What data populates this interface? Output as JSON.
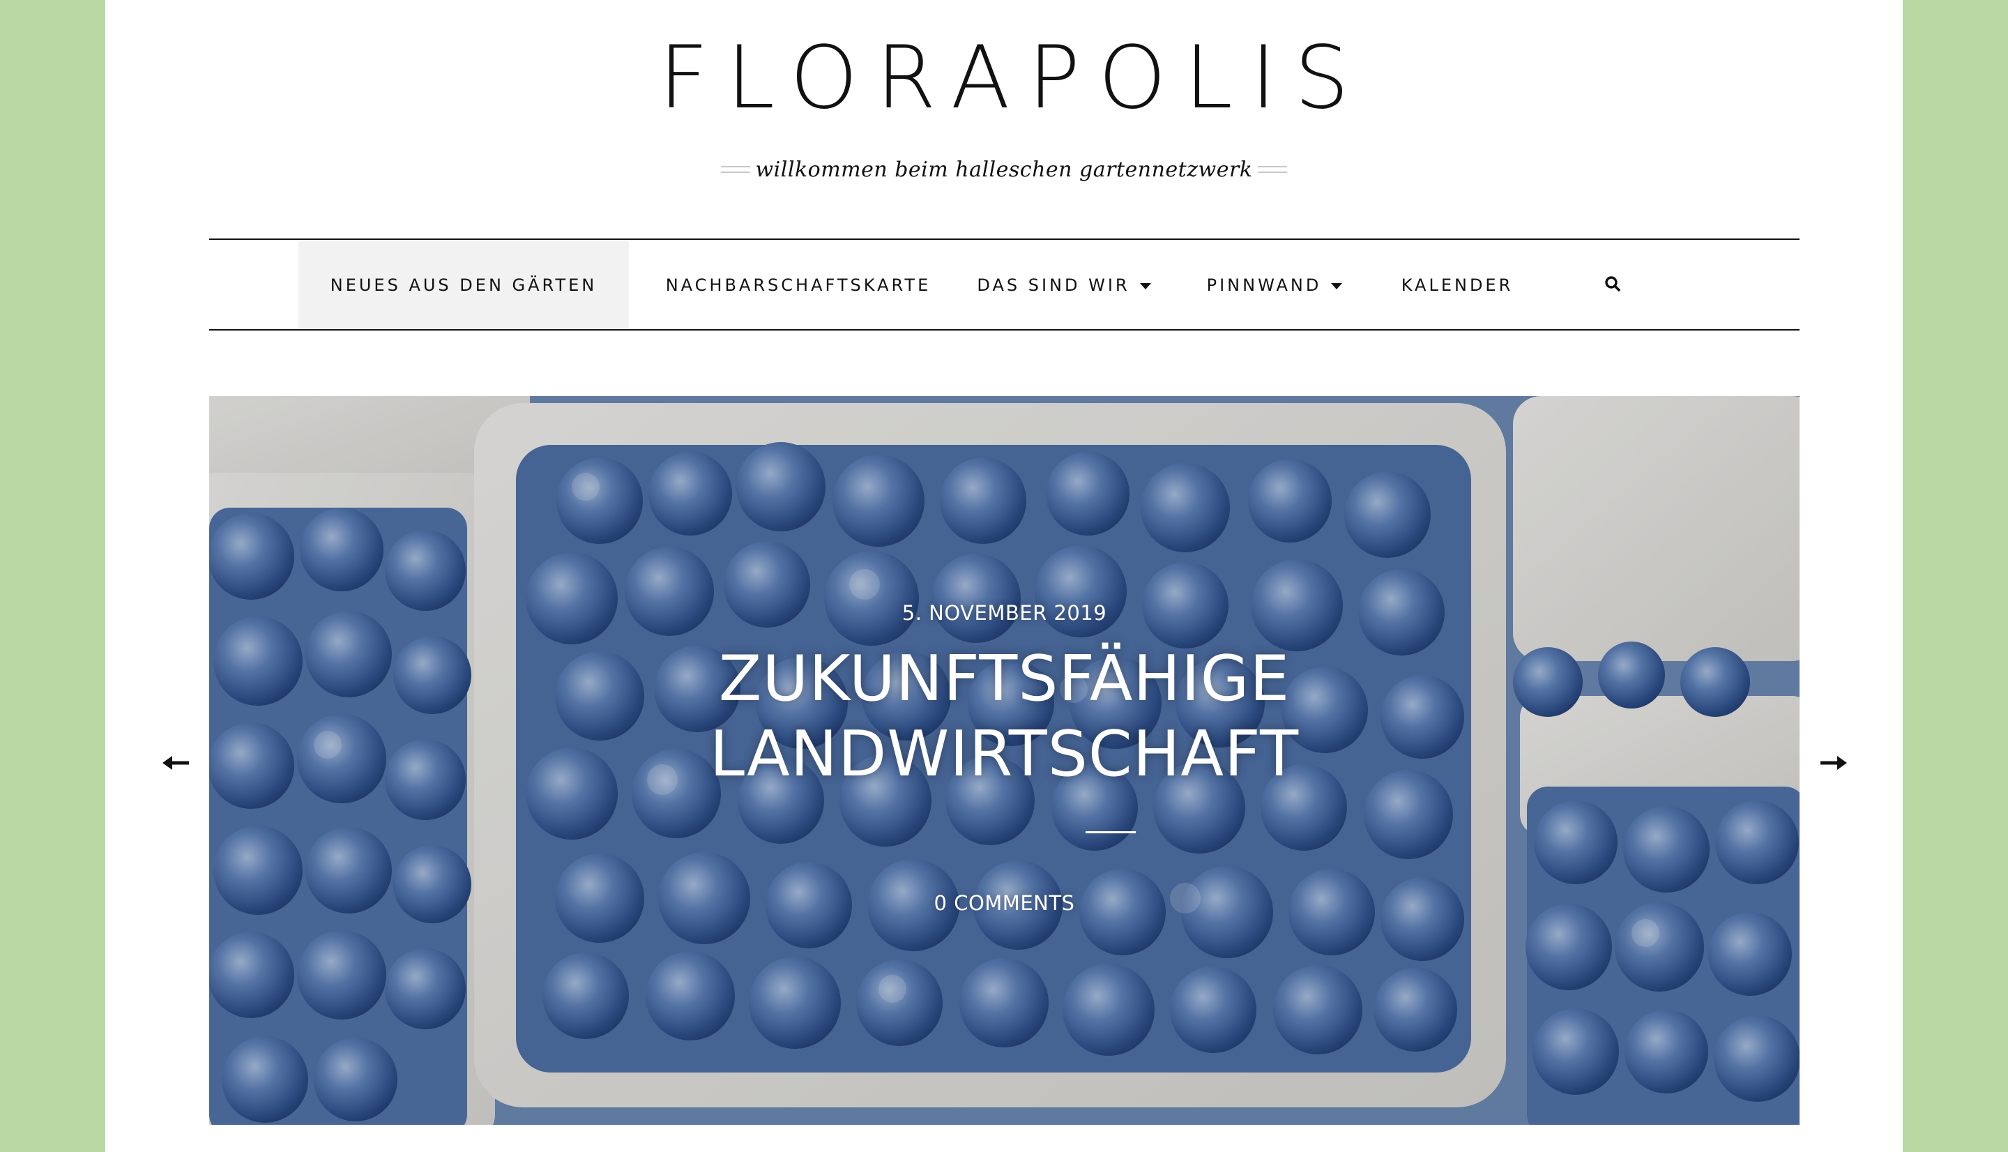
{
  "site": {
    "title": "FLORAPOLIS",
    "tagline": "willkommen beim halleschen gartennetzwerk"
  },
  "nav": {
    "items": [
      {
        "label": "NEUES AUS DEN GÄRTEN",
        "active": true,
        "has_dropdown": false
      },
      {
        "label": "NACHBARSCHAFTSKARTE",
        "active": false,
        "has_dropdown": false
      },
      {
        "label": "DAS SIND WIR",
        "active": false,
        "has_dropdown": true
      },
      {
        "label": "PINNWAND",
        "active": false,
        "has_dropdown": true
      },
      {
        "label": "KALENDER",
        "active": false,
        "has_dropdown": false
      }
    ],
    "search_icon": "search-icon"
  },
  "slider": {
    "date": "5. NOVEMBER 2019",
    "title_line1": "ZUKUNFTSFÄHIGE",
    "title_line2": "LANDWIRTSCHAFT",
    "comments": "0 COMMENTS",
    "prev_icon": "arrow-left-icon",
    "next_icon": "arrow-right-icon",
    "image_subject": "blueberries"
  },
  "colors": {
    "background": "#b9d8a3",
    "page": "#ffffff",
    "text": "#111111",
    "active_nav": "#f2f2f2"
  }
}
